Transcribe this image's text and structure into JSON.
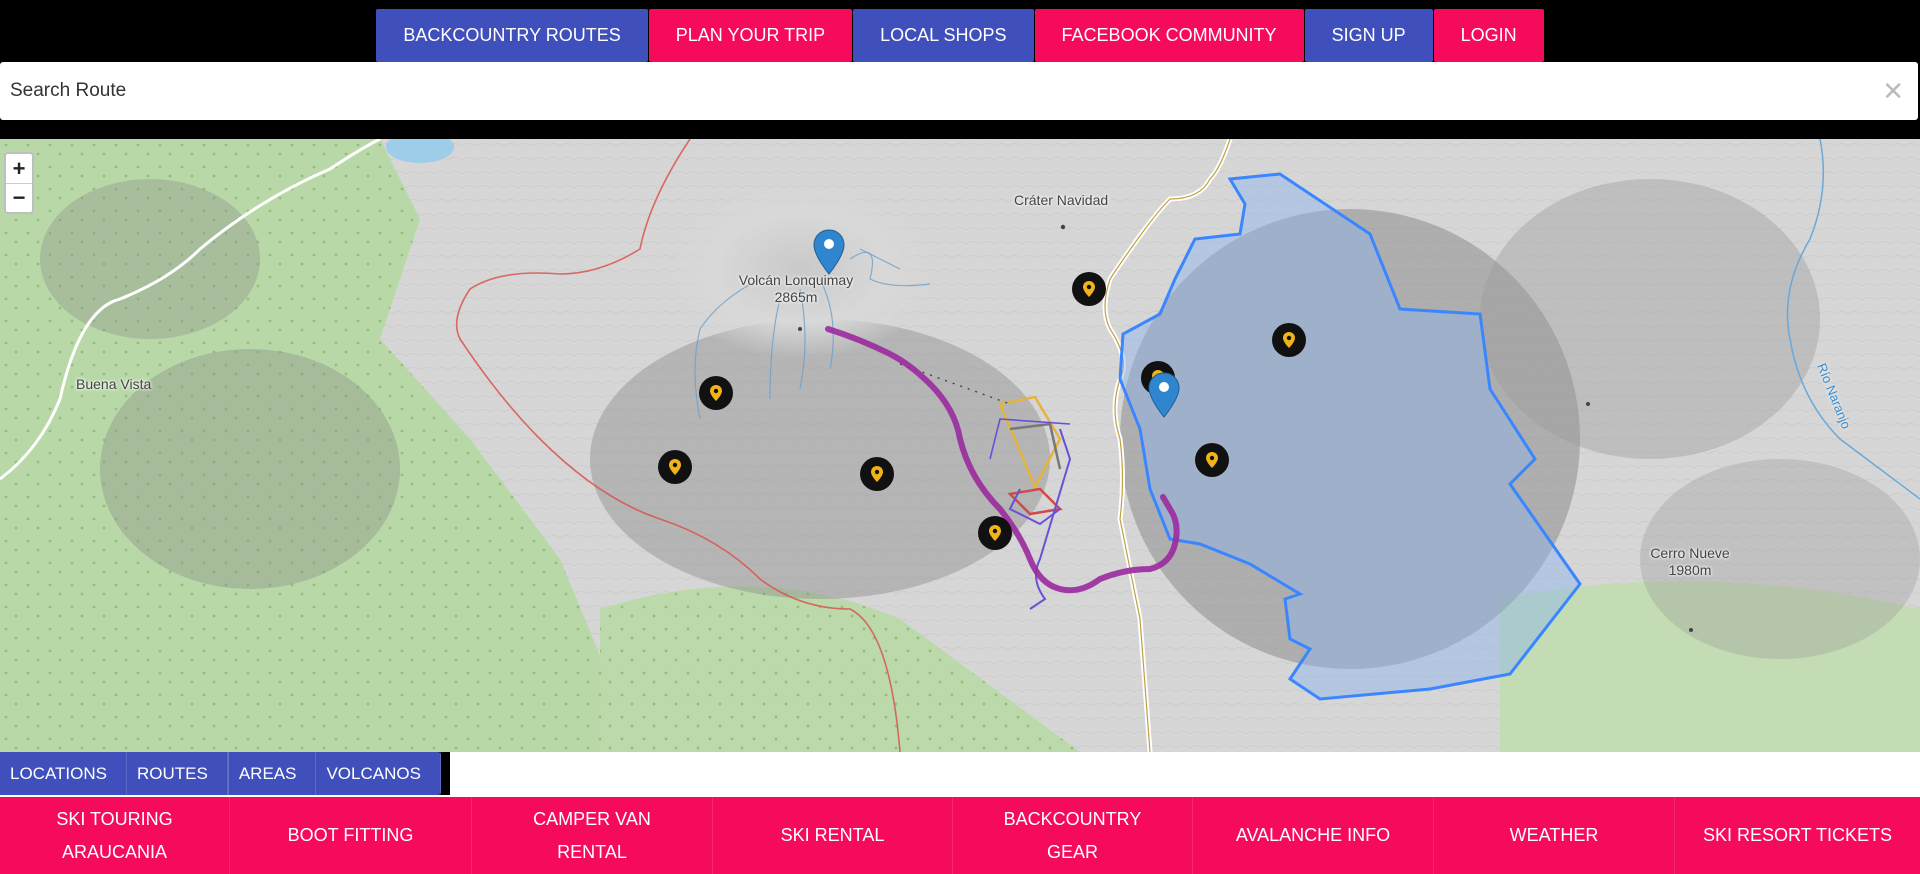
{
  "top_nav": [
    {
      "label": "BACKCOUNTRY ROUTES",
      "style": "blue"
    },
    {
      "label": "PLAN YOUR TRIP",
      "style": "pink"
    },
    {
      "label": "LOCAL SHOPS",
      "style": "blue"
    },
    {
      "label": "FACEBOOK COMMUNITY",
      "style": "pink"
    },
    {
      "label": "SIGN UP",
      "style": "blue"
    },
    {
      "label": "LOGIN",
      "style": "pink"
    }
  ],
  "search": {
    "placeholder": "Search Route",
    "clear_icon": "close-icon"
  },
  "map": {
    "zoom_in": "+",
    "zoom_out": "−",
    "labels": {
      "crater": "Cráter Navidad",
      "volcano_name": "Volcán Lonquimay",
      "volcano_elev": "2865m",
      "buena_vista": "Buena Vista",
      "cerro_name": "Cerro Nueve",
      "cerro_elev": "1980m",
      "river": "Río Naranjo"
    },
    "marker_icon": "map-pin-icon",
    "poi_icon": "location-pin-icon"
  },
  "layer_tabs": [
    "LOCATIONS",
    "ROUTES",
    "AREAS",
    "VOLCANOS"
  ],
  "bottom_nav": [
    {
      "line1": "SKI TOURING",
      "line2": "ARAUCANIA"
    },
    {
      "line1": "BOOT FITTING",
      "line2": ""
    },
    {
      "line1": "CAMPER VAN",
      "line2": "RENTAL"
    },
    {
      "line1": "SKI RENTAL",
      "line2": ""
    },
    {
      "line1": "BACKCOUNTRY",
      "line2": "GEAR"
    },
    {
      "line1": "AVALANCHE INFO",
      "line2": ""
    },
    {
      "line1": "WEATHER",
      "line2": ""
    },
    {
      "line1": "SKI RESORT TICKETS",
      "line2": ""
    }
  ],
  "colors": {
    "brand_blue": "#3f4fbb",
    "brand_pink": "#f50a5c",
    "route_purple": "#9b2a9e",
    "area_blue": "#3a86ff"
  }
}
